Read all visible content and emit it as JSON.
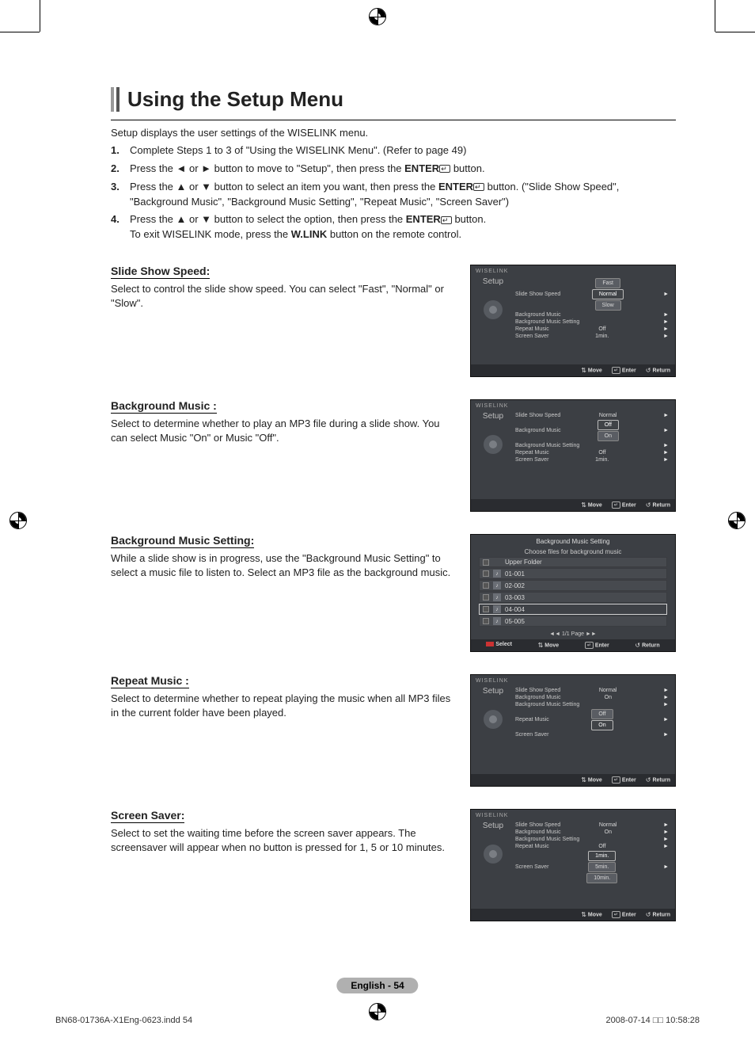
{
  "heading": "Using the Setup Menu",
  "intro": "Setup displays the user settings of the WISELINK menu.",
  "steps": [
    {
      "n": "1.",
      "text": "Complete Steps 1 to 3 of \"Using the WISELINK Menu\". (Refer to page 49)"
    },
    {
      "n": "2.",
      "pre": "Press the ◄ or ► button to move to \"Setup\", then press the ",
      "bold": "ENTER",
      "post": " button."
    },
    {
      "n": "3.",
      "pre": "Press the ▲ or ▼ button to select an item you want, then press the ",
      "bold": "ENTER",
      "post": " button. (\"Slide Show Speed\", \"Background Music\", \"Background Music Setting\", \"Repeat Music\", \"Screen Saver\")"
    },
    {
      "n": "4.",
      "pre": "Press the ▲ or ▼ button to select the option, then press the ",
      "bold": "ENTER",
      "post": " button.",
      "extra_pre": "To exit WISELINK mode, press the ",
      "extra_bold": "W.LINK",
      "extra_post": " button on the remote control."
    }
  ],
  "sections": {
    "slide": {
      "h": "Slide Show Speed:",
      "p": "Select to control the slide show speed. You can select \"Fast\", \"Normal\" or \"Slow\"."
    },
    "bgm": {
      "h": "Background Music :",
      "p": "Select to determine whether to play an MP3 file during a slide show. You can select Music \"On\" or Music \"Off\"."
    },
    "bgmset": {
      "h": "Background Music Setting:",
      "p": "While a slide show is in progress, use the \"Background Music Setting\" to select a music file to listen to. Select an MP3 file as the background music."
    },
    "repeat": {
      "h": "Repeat Music :",
      "p": "Select to determine whether to repeat playing the music when all MP3 files in the current folder have been played."
    },
    "saver": {
      "h": "Screen Saver:",
      "p": "Select to set the waiting time before the screen saver appears. The screensaver will appear when no button is pressed for 1, 5 or 10 minutes."
    }
  },
  "osd_common": {
    "brand": "WISELINK",
    "setup": "Setup",
    "move": "Move",
    "enter": "Enter",
    "return": "Return",
    "select": "Select"
  },
  "osd1": {
    "rows": [
      {
        "lbl": "Slide Show Speed",
        "opts": [
          "Fast",
          "Normal",
          "Slow"
        ],
        "sel": 1
      },
      {
        "lbl": "Background Music",
        "val": ""
      },
      {
        "lbl": "Background Music Setting",
        "val": ""
      },
      {
        "lbl": "Repeat Music",
        "val": "Off"
      },
      {
        "lbl": "Screen Saver",
        "val": "1min."
      }
    ]
  },
  "osd2": {
    "rows": [
      {
        "lbl": "Slide Show Speed",
        "val": "Normal"
      },
      {
        "lbl": "Background Music",
        "opts": [
          "Off",
          "On"
        ],
        "sel": 0
      },
      {
        "lbl": "Background Music Setting",
        "val": ""
      },
      {
        "lbl": "Repeat Music",
        "val": "Off"
      },
      {
        "lbl": "Screen Saver",
        "val": "1min."
      }
    ]
  },
  "osd3": {
    "title": "Background Music Setting",
    "sub": "Choose files for background music",
    "upper": "Upper Folder",
    "files": [
      "01-001",
      "02-002",
      "03-003",
      "04-004",
      "05-005"
    ],
    "sel_index": 3,
    "pager": "◄◄ 1/1 Page ►►"
  },
  "osd4": {
    "rows": [
      {
        "lbl": "Slide Show Speed",
        "val": "Normal"
      },
      {
        "lbl": "Background Music",
        "val": "On"
      },
      {
        "lbl": "Background Music Setting",
        "val": ""
      },
      {
        "lbl": "Repeat Music",
        "opts": [
          "Off",
          "On"
        ],
        "sel": 1
      },
      {
        "lbl": "Screen Saver",
        "val": ""
      }
    ]
  },
  "osd5": {
    "rows": [
      {
        "lbl": "Slide Show Speed",
        "val": "Normal"
      },
      {
        "lbl": "Background Music",
        "val": "On"
      },
      {
        "lbl": "Background Music Setting",
        "val": ""
      },
      {
        "lbl": "Repeat Music",
        "val": "Off"
      },
      {
        "lbl": "Screen Saver",
        "opts": [
          "1min.",
          "5min.",
          "10min."
        ],
        "sel": 0
      }
    ]
  },
  "page_foot": "English - 54",
  "doc_meta_left": "BN68-01736A-X1Eng-0623.indd   54",
  "doc_meta_right": "2008-07-14   □□ 10:58:28"
}
